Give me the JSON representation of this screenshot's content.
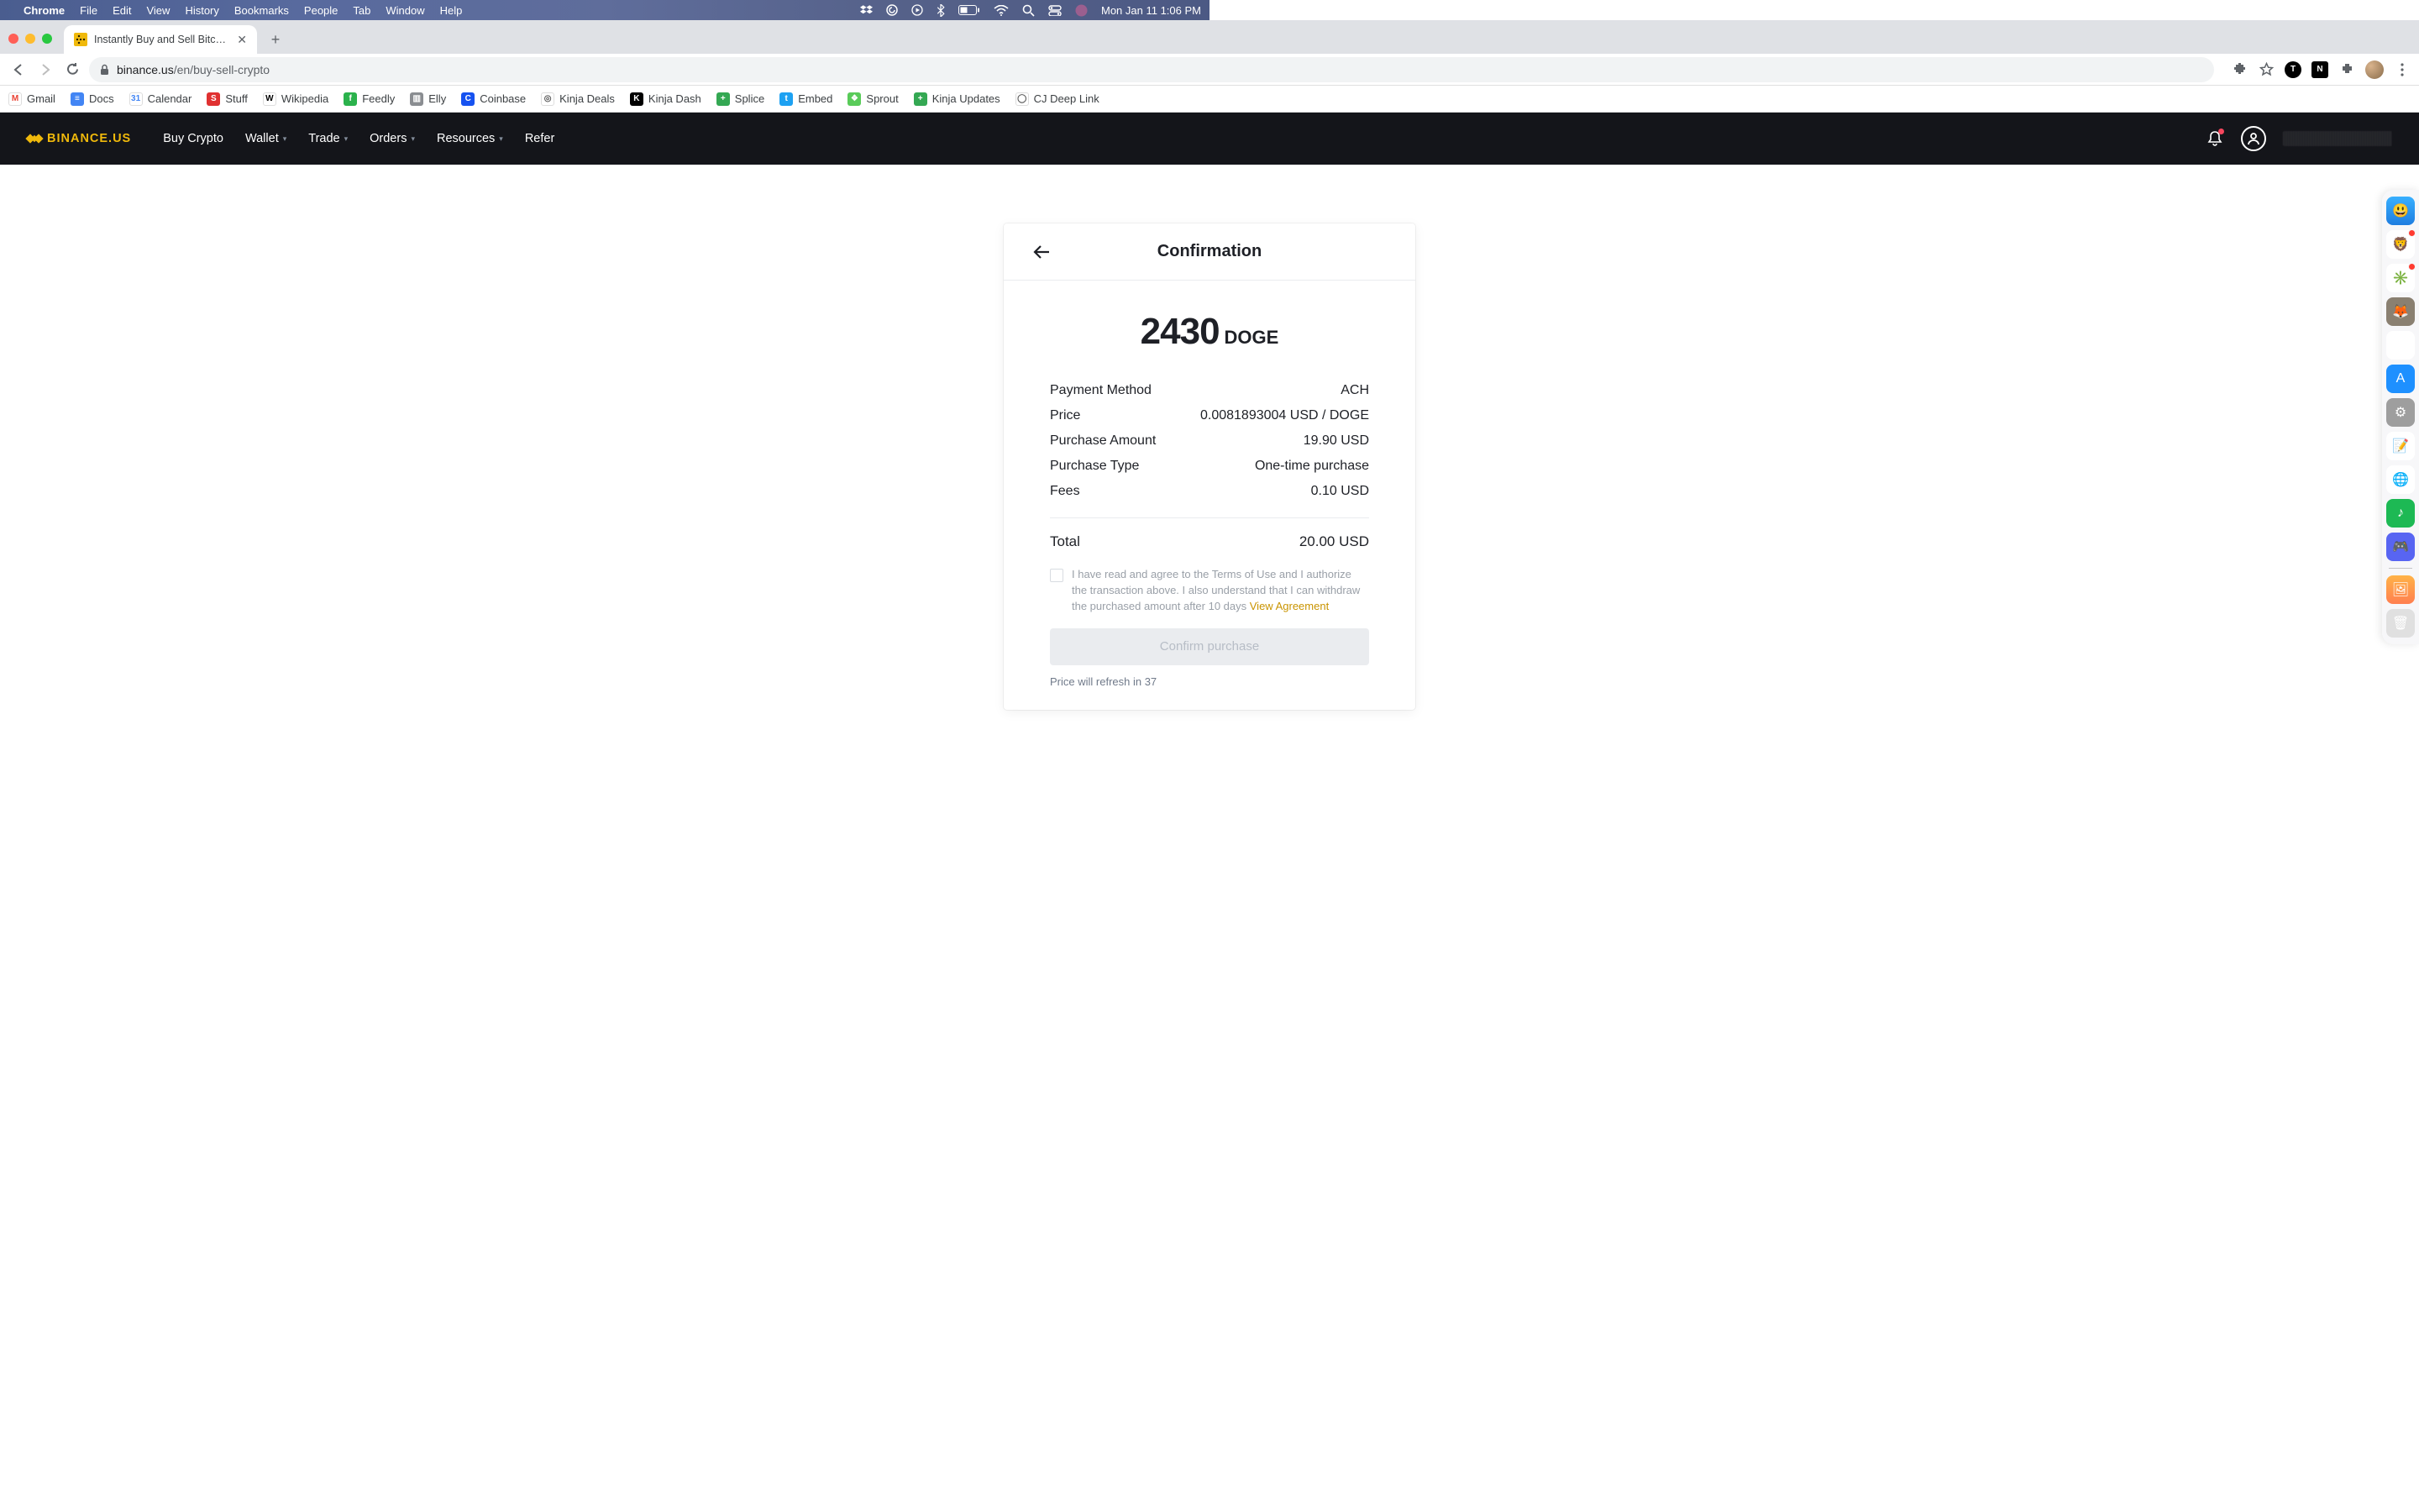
{
  "mac_menu": {
    "app_name": "Chrome",
    "items": [
      "File",
      "Edit",
      "View",
      "History",
      "Bookmarks",
      "People",
      "Tab",
      "Window",
      "Help"
    ],
    "clock": "Mon Jan 11  1:06 PM"
  },
  "chrome": {
    "tab_title": "Instantly Buy and Sell Bitcoin, E",
    "url_host": "binance.us",
    "url_path": "/en/buy-sell-crypto",
    "bookmarks": [
      {
        "label": "Gmail",
        "color": "#ffffff",
        "txt": "M",
        "fg": "#ea4335"
      },
      {
        "label": "Docs",
        "color": "#4285f4",
        "txt": "≡"
      },
      {
        "label": "Calendar",
        "color": "#ffffff",
        "txt": "31",
        "fg": "#4285f4"
      },
      {
        "label": "Stuff",
        "color": "#e03131",
        "txt": "S"
      },
      {
        "label": "Wikipedia",
        "color": "#ffffff",
        "txt": "W",
        "fg": "#000"
      },
      {
        "label": "Feedly",
        "color": "#2bb24c",
        "txt": "f"
      },
      {
        "label": "Elly",
        "color": "#8a8d91",
        "txt": "▥"
      },
      {
        "label": "Coinbase",
        "color": "#1652f0",
        "txt": "C"
      },
      {
        "label": "Kinja Deals",
        "color": "#ffffff",
        "txt": "◎",
        "fg": "#555"
      },
      {
        "label": "Kinja Dash",
        "color": "#000000",
        "txt": "K"
      },
      {
        "label": "Splice",
        "color": "#34a853",
        "txt": "+"
      },
      {
        "label": "Embed",
        "color": "#1da1f2",
        "txt": "t"
      },
      {
        "label": "Sprout",
        "color": "#59cb59",
        "txt": "❖"
      },
      {
        "label": "Kinja Updates",
        "color": "#34a853",
        "txt": "+"
      },
      {
        "label": "CJ Deep Link",
        "color": "#ffffff",
        "txt": "◯",
        "fg": "#555"
      }
    ]
  },
  "site_nav": {
    "brand": "BINANCE.US",
    "items": [
      {
        "label": "Buy Crypto",
        "caret": false
      },
      {
        "label": "Wallet",
        "caret": true
      },
      {
        "label": "Trade",
        "caret": true
      },
      {
        "label": "Orders",
        "caret": true
      },
      {
        "label": "Resources",
        "caret": true
      },
      {
        "label": "Refer",
        "caret": false
      }
    ]
  },
  "card": {
    "title": "Confirmation",
    "amount": "2430",
    "symbol": "DOGE",
    "rows": [
      {
        "label": "Payment Method",
        "value": "ACH"
      },
      {
        "label": "Price",
        "value": "0.0081893004 USD / DOGE"
      },
      {
        "label": "Purchase Amount",
        "value": "19.90 USD"
      },
      {
        "label": "Purchase Type",
        "value": "One-time purchase"
      },
      {
        "label": "Fees",
        "value": "0.10 USD"
      }
    ],
    "total_label": "Total",
    "total_value": "20.00 USD",
    "agree_text": "I have read and agree to the Terms of Use and I authorize the transaction above. I also understand that I can withdraw the purchased amount after 10 days ",
    "agree_link": "View Agreement",
    "confirm_label": "Confirm purchase",
    "refresh_prefix": "Price will refresh in ",
    "refresh_seconds": "37"
  },
  "dock": [
    {
      "name": "finder",
      "bg": "linear-gradient(#38b0ff,#1e7de0)",
      "glyph": "😃",
      "badge": false
    },
    {
      "name": "brave",
      "bg": "#fff",
      "glyph": "🦁",
      "badge": true
    },
    {
      "name": "slack",
      "bg": "#fff",
      "glyph": "✳️",
      "badge": true
    },
    {
      "name": "gimp",
      "bg": "#8a8071",
      "glyph": "🦊",
      "badge": false
    },
    {
      "name": "launchpad",
      "bg": "#fff",
      "glyph": "▦",
      "badge": false
    },
    {
      "name": "appstore",
      "bg": "#1e90ff",
      "glyph": "A",
      "badge": false
    },
    {
      "name": "settings",
      "bg": "#9e9e9e",
      "glyph": "⚙",
      "badge": false
    },
    {
      "name": "textedit",
      "bg": "#fff",
      "glyph": "📝",
      "badge": false
    },
    {
      "name": "chrome",
      "bg": "#fff",
      "glyph": "🌐",
      "badge": false
    },
    {
      "name": "spotify",
      "bg": "#1db954",
      "glyph": "♪",
      "badge": false
    },
    {
      "name": "discord",
      "bg": "#5865f2",
      "glyph": "🎮",
      "badge": false
    },
    {
      "name": "sep"
    },
    {
      "name": "folder",
      "bg": "linear-gradient(#ffb347,#ff7f50)",
      "glyph": "🖼",
      "badge": false
    },
    {
      "name": "trash",
      "bg": "#e0e0e0",
      "glyph": "🗑",
      "badge": false
    }
  ]
}
